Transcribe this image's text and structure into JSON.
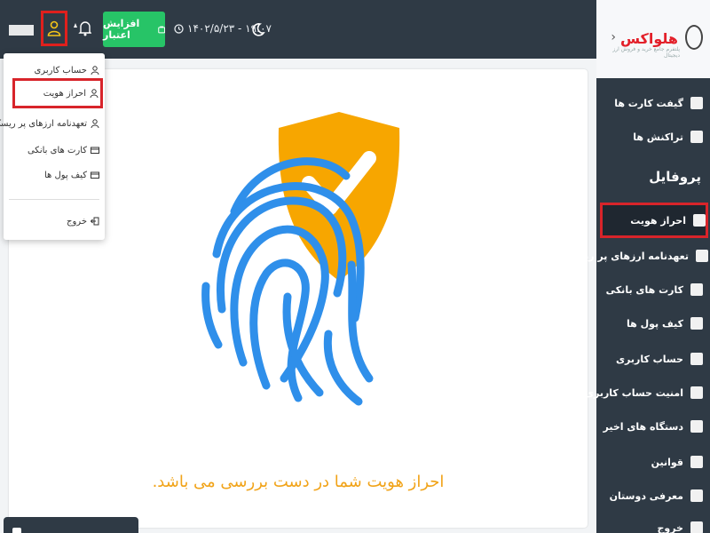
{
  "topbar": {
    "credit_label": "افزایش اعتبار",
    "datetime": "۱۴۰۲/۵/۲۳ - ۱۹:۰۷"
  },
  "dropdown": {
    "items": [
      {
        "label": "حساب کاربری",
        "icon": "user-icon"
      },
      {
        "label": "احراز هویت",
        "icon": "user-icon"
      },
      {
        "label": "تعهدنامه ارزهای پر ریسک",
        "icon": "user-icon"
      },
      {
        "label": "کارت های بانکی",
        "icon": "card-icon"
      },
      {
        "label": "کیف پول ها",
        "icon": "wallet-icon"
      }
    ],
    "logout_label": "خروج"
  },
  "main": {
    "status_message": "احراز هویت شما در دست بررسی می باشد."
  },
  "sidebar": {
    "logo_text": "هلواکس",
    "logo_tagline": "پلتفرم جامع خرید و فروش ارز دیجیتال",
    "items_top": [
      {
        "label": "گیفت کارت ها",
        "icon": "gift-card-icon"
      },
      {
        "label": "تراکنش ها",
        "icon": "transactions-icon"
      }
    ],
    "section_title": "پروفایل",
    "items_profile": [
      {
        "label": "احراز هویت",
        "icon": "identity-icon"
      },
      {
        "label": "تعهدنامه ارزهای پر ریسک",
        "icon": "risk-icon"
      },
      {
        "label": "کارت های بانکی",
        "icon": "bank-card-icon"
      },
      {
        "label": "کیف پول ها",
        "icon": "wallet-icon"
      },
      {
        "label": "حساب کاربری",
        "icon": "user-icon"
      },
      {
        "label": "امنیت حساب کاربری",
        "icon": "shield-icon"
      },
      {
        "label": "دستگاه های اخیر",
        "icon": "device-icon"
      },
      {
        "label": "قوانین",
        "icon": "rules-icon"
      },
      {
        "label": "معرفی دوستان",
        "icon": "referral-icon"
      },
      {
        "label": "خروج",
        "icon": "logout-icon"
      }
    ]
  },
  "colors": {
    "sidebar_bg": "#2f3a45",
    "accent_green": "#27c467",
    "shield_orange": "#f7a600",
    "fingerprint_blue": "#2f8fea",
    "highlight_red": "#d8242a",
    "status_text": "#f1a318"
  }
}
